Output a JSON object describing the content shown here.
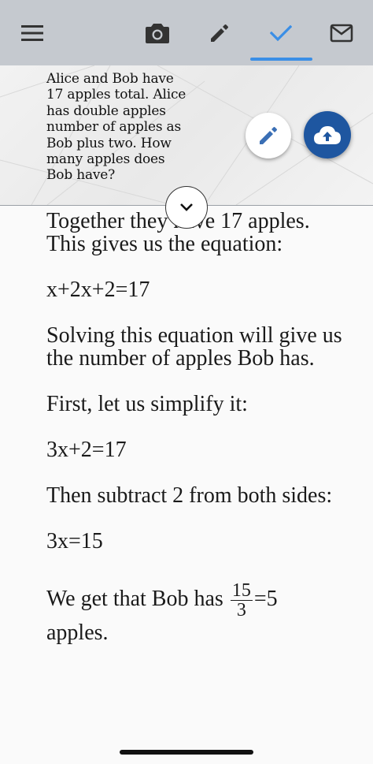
{
  "toolbar": {
    "tabs": [
      {
        "icon": "menu-icon"
      },
      {
        "icon": "camera-icon"
      },
      {
        "icon": "pencil-icon"
      },
      {
        "icon": "check-icon",
        "active": true
      },
      {
        "icon": "mail-icon"
      }
    ],
    "active_color": "#3a8ee6",
    "icon_color": "#333333"
  },
  "question": {
    "text": "Alice and Bob have 17 apples total. Alice has double apples number of apples as Bob plus two. How many apples does Bob have?",
    "edit_icon": "pencil-icon",
    "upload_icon": "cloud-upload-icon",
    "upload_color": "#1e56a0",
    "expand_icon": "chevron-down-icon"
  },
  "solution": {
    "p1": "Together they have 17 apples. This gives us the equation:",
    "eq1": "x+2x+2=17",
    "p2": "Solving this equation will give us the number of apples Bob has.",
    "p3": "First, let us simplify it:",
    "eq2": "3x+2=17",
    "p4": "Then subtract 2 from both sides:",
    "eq3": "3x=15",
    "p5_before": "We get that Bob has",
    "frac_num": "15",
    "frac_den": "3",
    "p5_after": "=5",
    "p5_end": "apples."
  }
}
